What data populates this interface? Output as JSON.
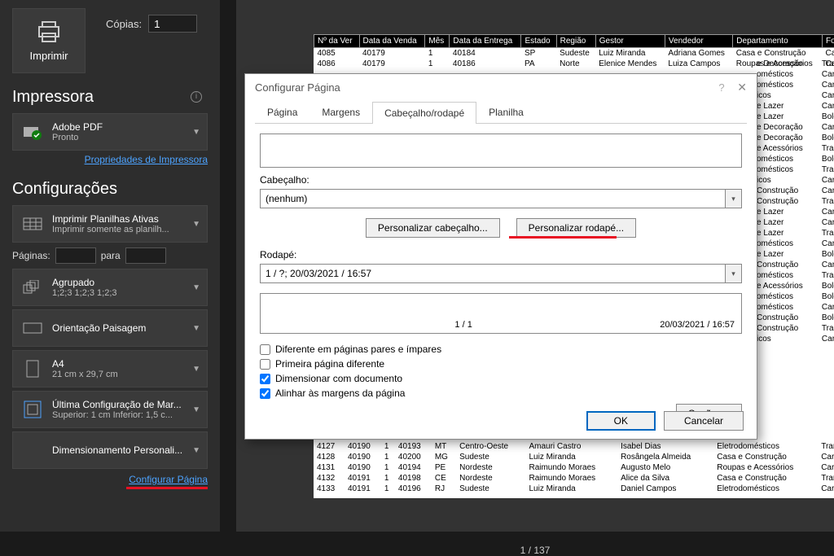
{
  "print": {
    "button": "Imprimir",
    "copies_label": "Cópias:",
    "copies_value": "1"
  },
  "printer": {
    "title": "Impressora",
    "name": "Adobe PDF",
    "status": "Pronto",
    "properties_link": "Propriedades de Impressora"
  },
  "settings": {
    "title": "Configurações",
    "active_sheets": {
      "line1": "Imprimir Planilhas Ativas",
      "line2": "Imprimir somente as planilh..."
    },
    "pages_label": "Páginas:",
    "pages_to": "para",
    "collate": {
      "line1": "Agrupado",
      "line2": "1;2;3   1;2;3   1;2;3"
    },
    "orientation": {
      "line1": "Orientação Paisagem"
    },
    "paper": {
      "line1": "A4",
      "line2": "21 cm x 29,7 cm"
    },
    "margins": {
      "line1": "Última Configuração de Mar...",
      "line2": "Superior: 1 cm Inferior: 1,5 c..."
    },
    "scaling": {
      "line1": "Dimensionamento Personali..."
    },
    "page_setup_link": "Configurar Página"
  },
  "dialog": {
    "title": "Configurar Página",
    "tabs": {
      "page": "Página",
      "margins": "Margens",
      "header_footer": "Cabeçalho/rodapé",
      "sheet": "Planilha"
    },
    "header_label": "Cabeçalho:",
    "header_value": "(nenhum)",
    "custom_header": "Personalizar cabeçalho...",
    "custom_footer": "Personalizar rodapé...",
    "footer_label": "Rodapé:",
    "footer_value": "1 / ?; 20/03/2021 / 16:57",
    "footer_preview_left": "1 / 1",
    "footer_preview_right": "20/03/2021 / 16:57",
    "diff_odd_even": "Diferente em páginas pares e ímpares",
    "diff_first": "Primeira página diferente",
    "scale_doc": "Dimensionar com documento",
    "align_margins": "Alinhar às margens da página",
    "options": "Opções...",
    "ok": "OK",
    "cancel": "Cancelar"
  },
  "table": {
    "headers": [
      "Nº da Ver",
      "Data da Venda",
      "Mês",
      "Data da Entrega",
      "Estado",
      "Região",
      "Gestor",
      "Vendedor",
      "Departamento",
      "Forn"
    ],
    "rows_top": [
      [
        "4085",
        "40179",
        "1",
        "40184",
        "SP",
        "Sudeste",
        "Luiz Miranda",
        "Adriana Gomes",
        "Casa e Construção",
        "Carta"
      ],
      [
        "4086",
        "40179",
        "1",
        "40186",
        "PA",
        "Norte",
        "Elenice Mendes",
        "Luiza Campos",
        "Roupas e Acessórios",
        "Carta"
      ]
    ],
    "rows_side": [
      [
        "e Decoração",
        "Tran"
      ],
      [
        "omésticos",
        "Carta"
      ],
      [
        "omésticos",
        "Carta"
      ],
      [
        "icos",
        "Carta"
      ],
      [
        "e Lazer",
        "Carta"
      ],
      [
        "e Lazer",
        "Bole"
      ],
      [
        "e Decoração",
        "Carta"
      ],
      [
        "e Decoração",
        "Bole"
      ],
      [
        "e Acessórios",
        "Tran"
      ],
      [
        "omésticos",
        "Bole"
      ],
      [
        "omésticos",
        "Tran"
      ],
      [
        "icos",
        "Carta"
      ],
      [
        "Construção",
        "Carta"
      ],
      [
        "Construção",
        "Tran"
      ],
      [
        "e Lazer",
        "Carta"
      ],
      [
        "e Lazer",
        "Carta"
      ],
      [
        "e Lazer",
        "Tran"
      ],
      [
        "omésticos",
        "Carta"
      ],
      [
        "e Lazer",
        "Bole"
      ],
      [
        "Construção",
        "Carta"
      ],
      [
        "omésticos",
        "Tran"
      ],
      [
        "e Acessórios",
        "Bole"
      ],
      [
        "omésticos",
        "Bole"
      ],
      [
        "omésticos",
        "Carta"
      ],
      [
        "Construção",
        "Bole"
      ],
      [
        "Construção",
        "Tran"
      ],
      [
        "icos",
        "Carta"
      ]
    ],
    "rows_bottom": [
      [
        "4128",
        "40190",
        "1",
        "40200",
        "MG",
        "Sudeste",
        "Luiz Miranda",
        "Rosângela Almeida",
        "Casa e Construção",
        "Carta"
      ],
      [
        "4131",
        "40190",
        "1",
        "40194",
        "PE",
        "Nordeste",
        "Raimundo Moraes",
        "Augusto Melo",
        "Roupas e Acessórios",
        "Carta"
      ],
      [
        "4132",
        "40191",
        "1",
        "40198",
        "CE",
        "Nordeste",
        "Raimundo Moraes",
        "Alice da Silva",
        "Casa e Construção",
        "Tran"
      ],
      [
        "4133",
        "40191",
        "1",
        "40196",
        "RJ",
        "Sudeste",
        "Luiz Miranda",
        "Daniel Campos",
        "Eletrodomésticos",
        "Carta"
      ]
    ],
    "rows_extra_top": [
      "4127",
      "40190",
      "1",
      "40193",
      "MT",
      "Centro-Oeste",
      "Amauri Castro",
      "Isabel Dias",
      "Eletrodomésticos",
      "Tran"
    ]
  },
  "page_indicator": "1 / 137"
}
